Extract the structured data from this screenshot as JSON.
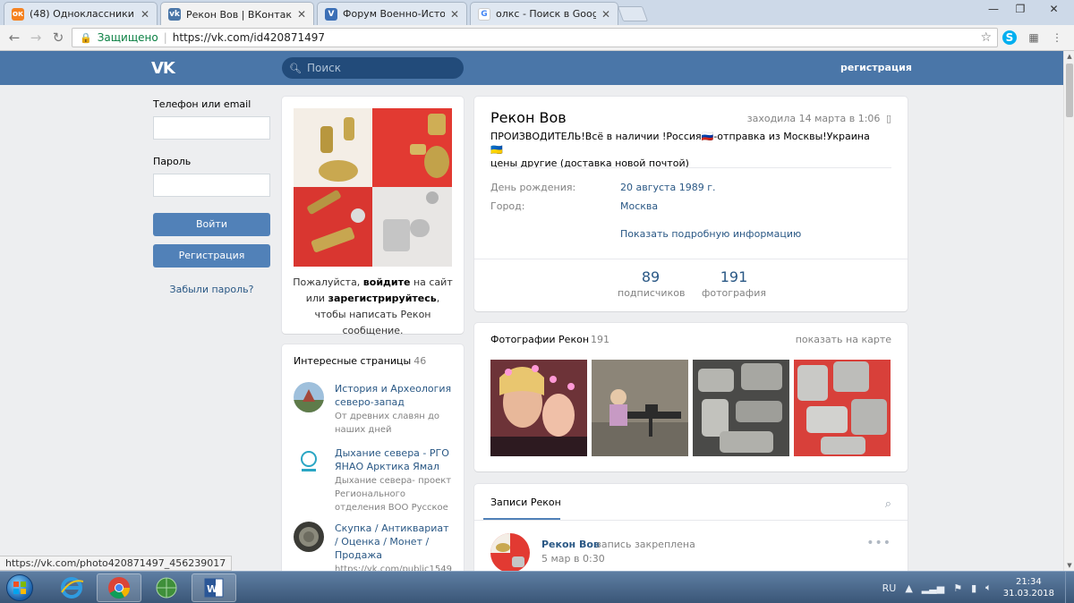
{
  "browser": {
    "tabs": [
      {
        "label": "(48) Одноклассники",
        "favicon": "odnoklassniki-icon",
        "color": "#f58220",
        "active": false
      },
      {
        "label": "Рекон Вов | ВКонтакте",
        "favicon": "vk-icon",
        "color": "#4a76a8",
        "active": true
      },
      {
        "label": "Форум Военно-Историч",
        "favicon": "forum-icon",
        "color": "#3b6fb6",
        "active": false
      },
      {
        "label": "олкс - Поиск в Google",
        "favicon": "google-icon",
        "color": "#4285f4",
        "active": false
      }
    ],
    "address": {
      "secure_label": "Защищено",
      "url": "https://vk.com/id420871497"
    },
    "status_url": "https://vk.com/photo420871497_456239017"
  },
  "vk_header": {
    "logo": "VK",
    "search_placeholder": "Поиск",
    "register_link": "регистрация"
  },
  "login": {
    "phone_label": "Телефон или email",
    "password_label": "Пароль",
    "login_button": "Войти",
    "register_button": "Регистрация",
    "forgot_link": "Забыли пароль?"
  },
  "avatar_card": {
    "note_before": "Пожалуйста, ",
    "note_login": "войдите",
    "note_middle": " на сайт или ",
    "note_register": "зарегистрируйтесь",
    "note_after": ", чтобы написать Рекон сообщение."
  },
  "interesting_pages": {
    "title": "Интересные страницы",
    "count": "46",
    "items": [
      {
        "name": "История и Археология северо-запад",
        "desc": "От древних славян до наших дней"
      },
      {
        "name": "Дыхание севера - РГО ЯНАО Арктика Ямал",
        "desc": "Дыхание севера- проект Регионального отделения ВОО Русское"
      },
      {
        "name": "Скупка / Антиквариат / Оценка / Монет / Продажа",
        "desc": "https://vk.com/public1549"
      }
    ]
  },
  "profile": {
    "name": "Рекон Вов",
    "last_seen": "заходила 14 марта в 1:06",
    "status_line1": "ПРОИЗВОДИТЕЛЬ!Всё в наличии !Россия🇷🇺-отправка из Москвы!Украина 🇺🇦",
    "status_line2": "цены другие (доставка новой почтой)",
    "birthday_label": "День рождения:",
    "birthday_value": "20 августа 1989 г.",
    "city_label": "Город:",
    "city_value": "Москва",
    "more_link": "Показать подробную информацию",
    "followers_count": "89",
    "followers_label": "подписчиков",
    "photos_count": "191",
    "photos_label": "фотография"
  },
  "photos": {
    "title": "Фотографии Рекон",
    "count": "191",
    "map_link": "показать на карте"
  },
  "wall": {
    "tab_label": "Записи Рекон",
    "post_author": "Рекон Вов",
    "post_pinned": "запись закреплена",
    "post_date": "5 мар в 0:30"
  },
  "taskbar": {
    "lang": "RU",
    "time": "21:34",
    "date": "31.03.2018"
  }
}
